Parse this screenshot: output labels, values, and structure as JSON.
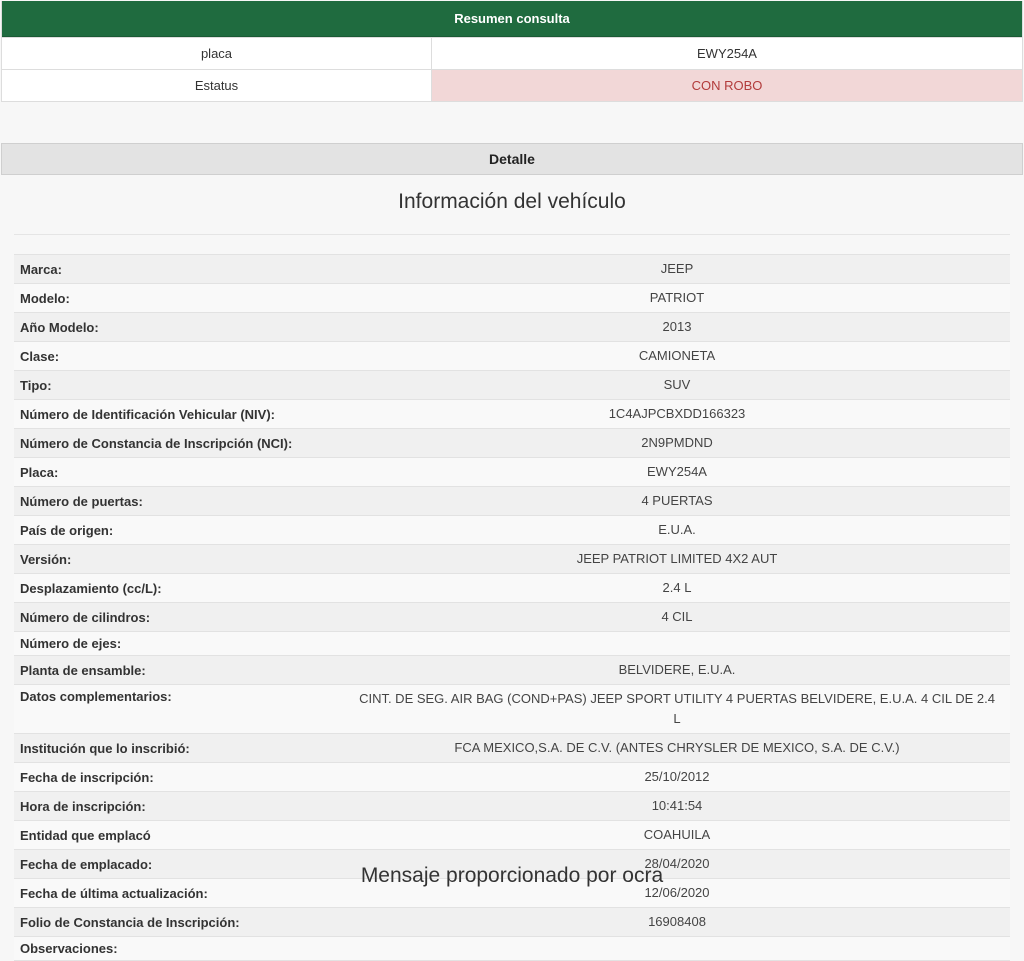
{
  "summary": {
    "title": "Resumen consulta",
    "rows": [
      {
        "label": "placa",
        "value": "EWY254A"
      },
      {
        "label": "Estatus",
        "value": "CON ROBO"
      }
    ]
  },
  "detail": {
    "header": "Detalle",
    "section_title": "Información del vehículo",
    "rows": [
      {
        "label": "Marca:",
        "value": "JEEP"
      },
      {
        "label": "Modelo:",
        "value": "PATRIOT"
      },
      {
        "label": "Año Modelo:",
        "value": "2013"
      },
      {
        "label": "Clase:",
        "value": "CAMIONETA"
      },
      {
        "label": "Tipo:",
        "value": "SUV"
      },
      {
        "label": "Número de Identificación Vehicular (NIV):",
        "value": "1C4AJPCBXDD166323"
      },
      {
        "label": "Número de Constancia de Inscripción (NCI):",
        "value": "2N9PMDND"
      },
      {
        "label": "Placa:",
        "value": "EWY254A"
      },
      {
        "label": "Número de puertas:",
        "value": "4 PUERTAS"
      },
      {
        "label": "País de origen:",
        "value": "E.U.A."
      },
      {
        "label": "Versión:",
        "value": "JEEP PATRIOT LIMITED 4X2 AUT"
      },
      {
        "label": "Desplazamiento (cc/L):",
        "value": "2.4 L"
      },
      {
        "label": "Número de cilindros:",
        "value": "4 CIL"
      },
      {
        "label": "Número de ejes:",
        "value": ""
      },
      {
        "label": "Planta de ensamble:",
        "value": "BELVIDERE, E.U.A."
      },
      {
        "label": "Datos complementarios:",
        "value": "CINT. DE SEG. AIR BAG (COND+PAS) JEEP SPORT UTILITY 4 PUERTAS BELVIDERE, E.U.A. 4 CIL DE 2.4 L"
      },
      {
        "label": "Institución que lo inscribió:",
        "value": "FCA MEXICO,S.A. DE C.V. (ANTES CHRYSLER DE MEXICO, S.A. DE C.V.)"
      },
      {
        "label": "Fecha de inscripción:",
        "value": "25/10/2012"
      },
      {
        "label": "Hora de inscripción:",
        "value": "10:41:54"
      },
      {
        "label": "Entidad que emplacó",
        "value": "COAHUILA"
      },
      {
        "label": "Fecha de emplacado:",
        "value": "28/04/2020"
      },
      {
        "label": "Fecha de última actualización:",
        "value": "12/06/2020"
      },
      {
        "label": "Folio de Constancia de Inscripción:",
        "value": "16908408"
      },
      {
        "label": "Observaciones:",
        "value": ""
      }
    ]
  },
  "footer": {
    "message": "Mensaje proporcionado por ocra"
  },
  "colors": {
    "header_green": "#1f6b3f",
    "danger_bg": "#f2d7d7",
    "danger_text": "#b23b3b"
  }
}
